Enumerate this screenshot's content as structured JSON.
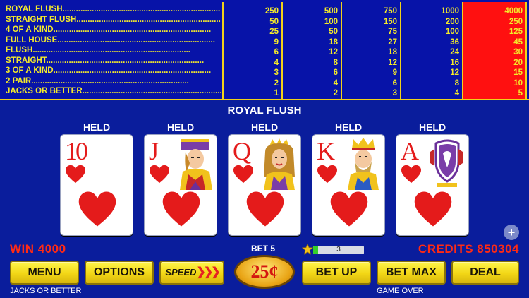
{
  "paytable": {
    "hands": [
      {
        "name": "ROYAL FLUSH",
        "payouts": [
          "250",
          "500",
          "750",
          "1000",
          "4000"
        ]
      },
      {
        "name": "STRAIGHT FLUSH",
        "payouts": [
          "50",
          "100",
          "150",
          "200",
          "250"
        ]
      },
      {
        "name": "4 OF A KIND",
        "payouts": [
          "25",
          "50",
          "75",
          "100",
          "125"
        ]
      },
      {
        "name": "FULL HOUSE",
        "payouts": [
          "9",
          "18",
          "27",
          "36",
          "45"
        ]
      },
      {
        "name": "FLUSH",
        "payouts": [
          "6",
          "12",
          "18",
          "24",
          "30"
        ]
      },
      {
        "name": "STRAIGHT",
        "payouts": [
          "4",
          "8",
          "12",
          "16",
          "20"
        ]
      },
      {
        "name": "3 OF A KIND",
        "payouts": [
          "3",
          "6",
          "9",
          "12",
          "15"
        ]
      },
      {
        "name": "2 PAIR",
        "payouts": [
          "2",
          "4",
          "6",
          "8",
          "10"
        ]
      },
      {
        "name": "JACKS OR BETTER",
        "payouts": [
          "1",
          "2",
          "3",
          "4",
          "5"
        ]
      }
    ],
    "highlight_color": "#ff1010",
    "text_color": "#f4ea2a"
  },
  "result": {
    "title": "ROYAL FLUSH"
  },
  "cards": [
    {
      "held_label": "HELD",
      "rank": "10",
      "suit": "hearts",
      "face": "none"
    },
    {
      "held_label": "HELD",
      "rank": "J",
      "suit": "hearts",
      "face": "jack"
    },
    {
      "held_label": "HELD",
      "rank": "Q",
      "suit": "hearts",
      "face": "queen"
    },
    {
      "held_label": "HELD",
      "rank": "K",
      "suit": "hearts",
      "face": "king"
    },
    {
      "held_label": "HELD",
      "rank": "A",
      "suit": "hearts",
      "face": "crest"
    }
  ],
  "status": {
    "win": "WIN 4000",
    "credits": "CREDITS 850304",
    "bet": "BET 5",
    "level_value": "3",
    "level_fraction": 0.1,
    "game_state": "GAME OVER",
    "game_name": "JACKS OR BETTER"
  },
  "buttons": {
    "menu": "MENU",
    "options": "OPTIONS",
    "speed": "SPEED",
    "denomination": "25¢",
    "bet_up": "BET UP",
    "bet_max": "BET MAX",
    "deal": "DEAL",
    "plus": "+"
  },
  "icons": {
    "star": "star-icon",
    "speed_chevrons": "chevrons-right-icon",
    "plus": "plus-circle-icon"
  }
}
